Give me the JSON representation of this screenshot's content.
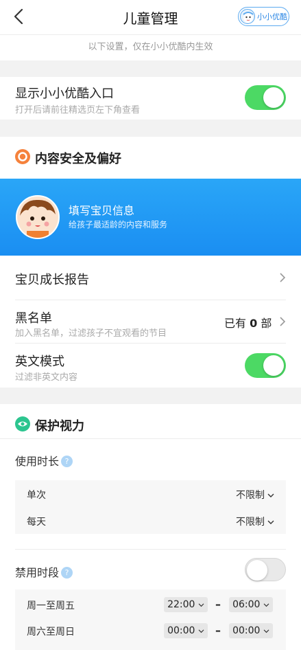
{
  "header": {
    "title": "儿童管理",
    "kid_mode_label": "小小优酷"
  },
  "notice": "以下设置，仅在小小优酷内生效",
  "entry": {
    "title": "显示小小优酷入口",
    "subtitle": "打开后请前往精选页左下角查看",
    "enabled": true
  },
  "content_section": {
    "title": "内容安全及偏好",
    "icon": "shield-icon",
    "icon_color": "#f5823c"
  },
  "banner": {
    "title": "填写宝贝信息",
    "subtitle": "给孩子最适龄的内容和服务",
    "color": "#1a8ef2"
  },
  "growth_report": {
    "title": "宝贝成长报告"
  },
  "blacklist": {
    "title": "黑名单",
    "subtitle": "加入黑名单，过滤孩子不宜观看的节目",
    "value_prefix": "已有",
    "count": "0",
    "value_suffix": "部"
  },
  "english_mode": {
    "title": "英文模式",
    "subtitle": "过滤非英文内容",
    "enabled": true
  },
  "eye_section": {
    "title": "保护视力",
    "icon": "eye-icon",
    "icon_color": "#2cc58f"
  },
  "usage": {
    "title": "使用时长",
    "help": "?",
    "rows": [
      {
        "label": "单次",
        "value": "不限制"
      },
      {
        "label": "每天",
        "value": "不限制"
      }
    ]
  },
  "forbidden": {
    "title": "禁用时段",
    "help": "?",
    "enabled": false,
    "rows": [
      {
        "label": "周一至周五",
        "start": "22:00",
        "end": "06:00"
      },
      {
        "label": "周六至周日",
        "start": "00:00",
        "end": "00:00"
      }
    ],
    "separator": "–"
  },
  "colors": {
    "toggle_on": "#4cd964",
    "accent_blue": "#1a8ef2"
  }
}
